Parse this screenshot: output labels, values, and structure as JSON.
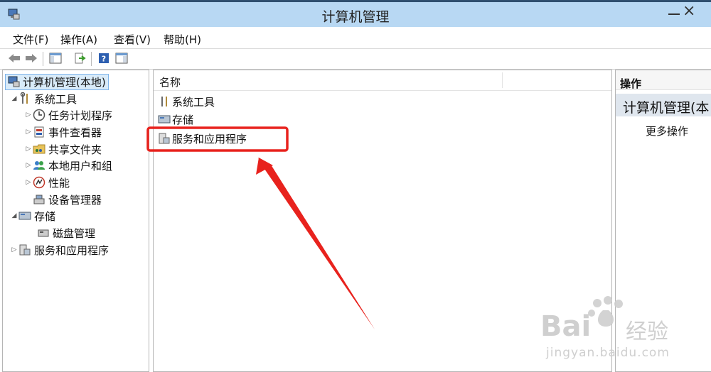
{
  "window": {
    "title": "计算机管理"
  },
  "menu": [
    "文件(F)",
    "操作(A)",
    "查看(V)",
    "帮助(H)"
  ],
  "tree": [
    {
      "label": "计算机管理(本地)",
      "icon": "computer-management-icon"
    },
    {
      "label": "系统工具",
      "icon": "tools-icon"
    },
    {
      "label": "任务计划程序",
      "icon": "clock-icon"
    },
    {
      "label": "事件查看器",
      "icon": "event-viewer-icon"
    },
    {
      "label": "共享文件夹",
      "icon": "shared-folder-icon"
    },
    {
      "label": "本地用户和组",
      "icon": "users-icon"
    },
    {
      "label": "性能",
      "icon": "performance-icon"
    },
    {
      "label": "设备管理器",
      "icon": "device-manager-icon"
    },
    {
      "label": "存储",
      "icon": "storage-icon"
    },
    {
      "label": "磁盘管理",
      "icon": "disk-icon"
    },
    {
      "label": "服务和应用程序",
      "icon": "services-icon"
    }
  ],
  "list": {
    "column_name": "名称",
    "items": [
      "系统工具",
      "存储",
      "服务和应用程序"
    ]
  },
  "actions": {
    "header": "操作",
    "subheader": "计算机管理(本",
    "more": "更多操作"
  },
  "watermark": {
    "brand": "Bai",
    "brand_cn": "经验",
    "url": "jingyan.baidu.com"
  },
  "colors": {
    "titlebar": "#b8d8f3",
    "highlight": "#e8221d",
    "selection": "#d9ebf9"
  }
}
